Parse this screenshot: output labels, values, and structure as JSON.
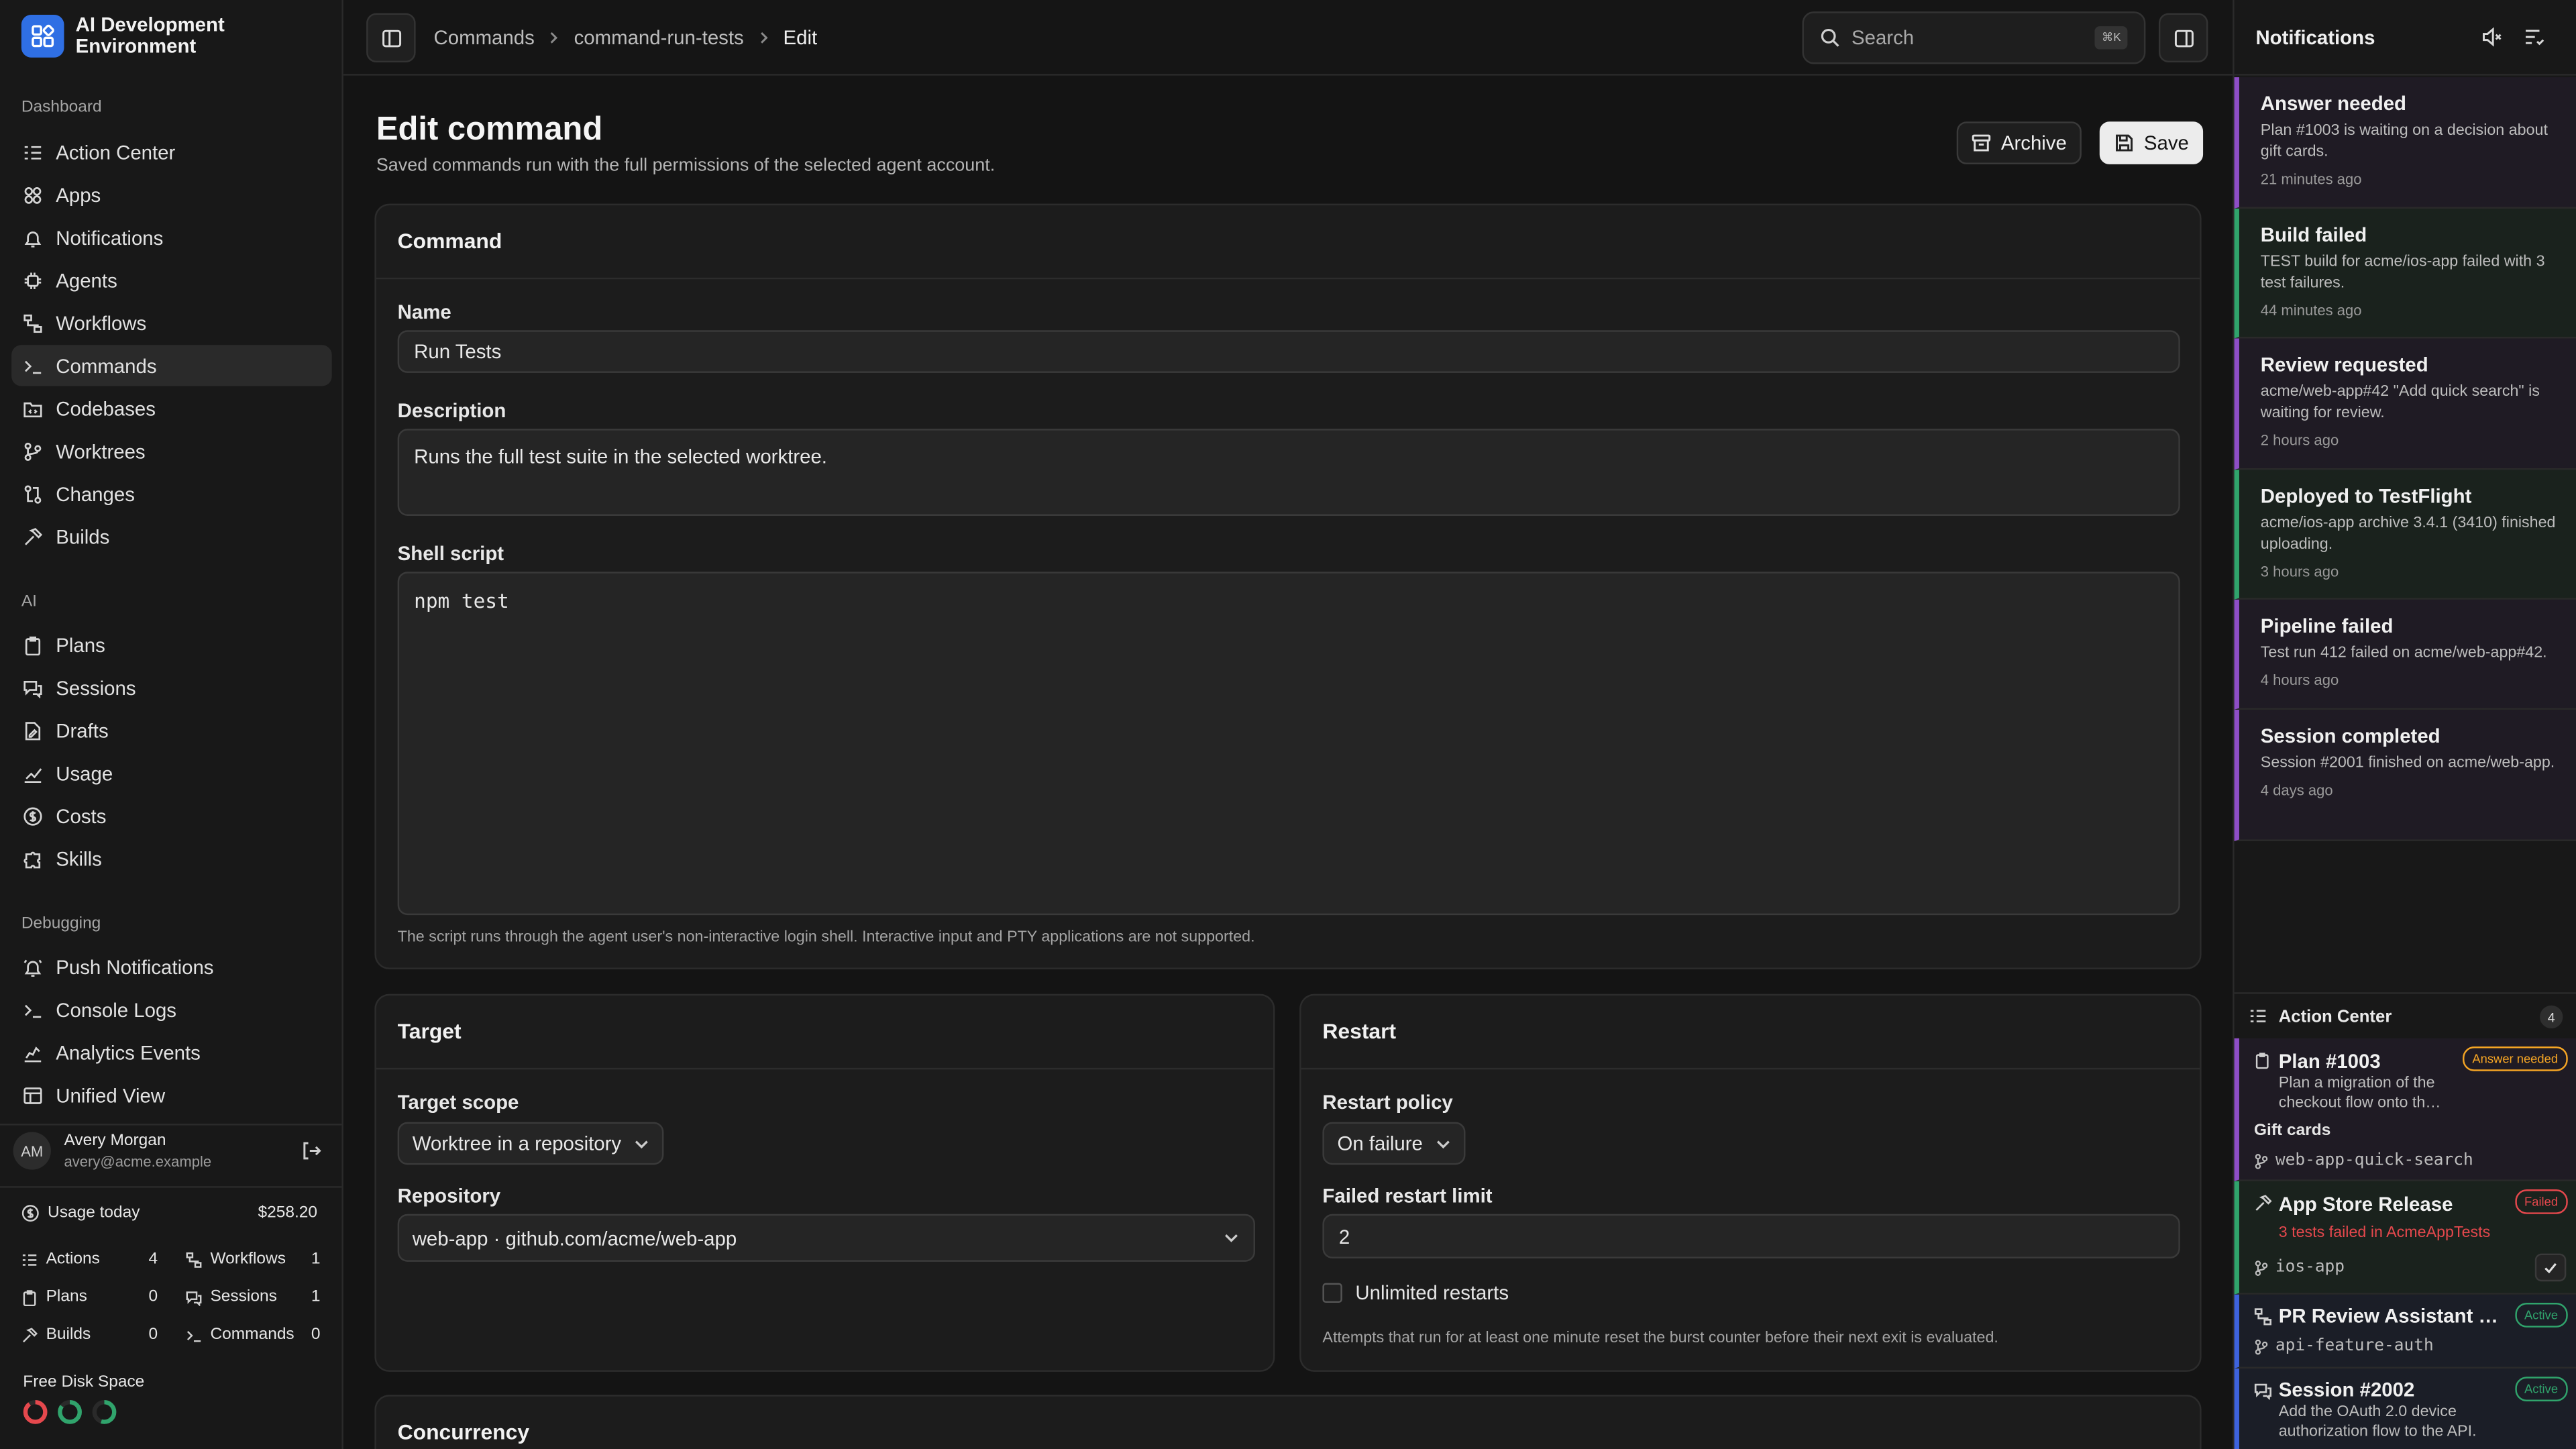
{
  "app": {
    "name": "AI Development Environment"
  },
  "sidebar": {
    "sections": [
      {
        "title": "Dashboard",
        "items": [
          {
            "label": "Action Center",
            "icon": "list-check-icon"
          },
          {
            "label": "Apps",
            "icon": "apps-icon"
          },
          {
            "label": "Notifications",
            "icon": "bell-icon"
          },
          {
            "label": "Agents",
            "icon": "chip-icon"
          },
          {
            "label": "Workflows",
            "icon": "workflow-icon"
          },
          {
            "label": "Commands",
            "icon": "terminal-icon",
            "active": true
          },
          {
            "label": "Codebases",
            "icon": "code-folder-icon"
          },
          {
            "label": "Worktrees",
            "icon": "git-branch-icon"
          },
          {
            "label": "Changes",
            "icon": "git-compare-icon"
          },
          {
            "label": "Builds",
            "icon": "hammer-icon"
          }
        ]
      },
      {
        "title": "AI",
        "items": [
          {
            "label": "Plans",
            "icon": "clipboard-icon"
          },
          {
            "label": "Sessions",
            "icon": "chat-icon"
          },
          {
            "label": "Drafts",
            "icon": "file-edit-icon"
          },
          {
            "label": "Usage",
            "icon": "chart-icon"
          },
          {
            "label": "Costs",
            "icon": "dollar-icon"
          },
          {
            "label": "Skills",
            "icon": "puzzle-icon"
          }
        ]
      },
      {
        "title": "Debugging",
        "items": [
          {
            "label": "Push Notifications",
            "icon": "bell-ring-icon"
          },
          {
            "label": "Console Logs",
            "icon": "terminal-icon"
          },
          {
            "label": "Analytics Events",
            "icon": "activity-icon"
          },
          {
            "label": "Unified View",
            "icon": "layout-icon"
          }
        ]
      }
    ],
    "user": {
      "initials": "AM",
      "name": "Avery Morgan",
      "email": "avery@acme.example"
    },
    "usage": {
      "label": "Usage today",
      "amount": "$258.20",
      "stats": [
        {
          "label": "Actions",
          "value": "4"
        },
        {
          "label": "Workflows",
          "value": "1"
        },
        {
          "label": "Plans",
          "value": "0"
        },
        {
          "label": "Sessions",
          "value": "1"
        },
        {
          "label": "Builds",
          "value": "0"
        },
        {
          "label": "Commands",
          "value": "0"
        }
      ]
    },
    "disk": {
      "label": "Free Disk Space",
      "rings": [
        0.9,
        0.85,
        0.55
      ],
      "colors": [
        "#e5484d",
        "#30a46c",
        "#30a46c"
      ]
    }
  },
  "topbar": {
    "breadcrumbs": [
      "Commands",
      "command-run-tests",
      "Edit"
    ],
    "search_placeholder": "Search",
    "search_shortcut": "⌘K"
  },
  "page": {
    "title": "Edit command",
    "subtitle": "Saved commands run with the full permissions of the selected agent account.",
    "archive_label": "Archive",
    "save_label": "Save"
  },
  "command_card": {
    "title": "Command",
    "name_label": "Name",
    "name_value": "Run Tests",
    "description_label": "Description",
    "description_value": "Runs the full test suite in the selected worktree.",
    "script_label": "Shell script",
    "script_value": "npm test",
    "script_hint": "The script runs through the agent user's non-interactive login shell. Interactive input and PTY applications are not supported."
  },
  "target_card": {
    "title": "Target",
    "scope_label": "Target scope",
    "scope_value": "Worktree in a repository",
    "repo_label": "Repository",
    "repo_value": "web-app · github.com/acme/web-app"
  },
  "restart_card": {
    "title": "Restart",
    "policy_label": "Restart policy",
    "policy_value": "On failure",
    "limit_label": "Failed restart limit",
    "limit_value": "2",
    "unlimited_label": "Unlimited restarts",
    "hint": "Attempts that run for at least one minute reset the burst counter before their next exit is evaluated."
  },
  "concurrency_card": {
    "title": "Concurrency"
  },
  "notifications": {
    "title": "Notifications",
    "items": [
      {
        "title": "Answer needed",
        "body": "Plan #1003 is waiting on a decision about gift cards.",
        "time": "21 minutes ago",
        "color": "#8e4ec6"
      },
      {
        "title": "Build failed",
        "body": "TEST build for acme/ios-app failed with 3 test failures.",
        "time": "44 minutes ago",
        "color": "#30a46c"
      },
      {
        "title": "Review requested",
        "body": "acme/web-app#42 \"Add quick search\" is waiting for review.",
        "time": "2 hours ago",
        "color": "#8e4ec6"
      },
      {
        "title": "Deployed to TestFlight",
        "body": "acme/ios-app archive 3.4.1 (3410) finished uploading.",
        "time": "3 hours ago",
        "color": "#30a46c"
      },
      {
        "title": "Pipeline failed",
        "body": "Test run 412 failed on acme/web-app#42.",
        "time": "4 hours ago",
        "color": "#8e4ec6"
      },
      {
        "title": "Session completed",
        "body": "Session #2001 finished on acme/web-app.",
        "time": "4 days ago",
        "color": "#8e4ec6"
      }
    ]
  },
  "action_center": {
    "title": "Action Center",
    "count": "4",
    "items": [
      {
        "title": "Plan #1003",
        "badge": "Answer needed",
        "desc": "Plan a migration of the checkout flow onto th…",
        "extra": "Gift cards",
        "branch": "web-app-quick-search",
        "color": "#8e4ec6",
        "badge_color": "#f5a524"
      },
      {
        "title": "App Store Release",
        "badge": "Failed",
        "desc": "3 tests failed in AcmeAppTests",
        "branch": "ios-app",
        "color": "#30a46c",
        "badge_color": "#e5484d"
      },
      {
        "title": "PR Review Assistant #4…",
        "badge": "Active",
        "branch": "api-feature-auth",
        "color": "#3e63dd",
        "badge_color": "#30a46c"
      },
      {
        "title": "Session #2002",
        "badge": "Active",
        "desc": "Add the OAuth 2.0 device authorization flow to the API.",
        "color": "#3e63dd",
        "badge_color": "#30a46c"
      }
    ]
  }
}
